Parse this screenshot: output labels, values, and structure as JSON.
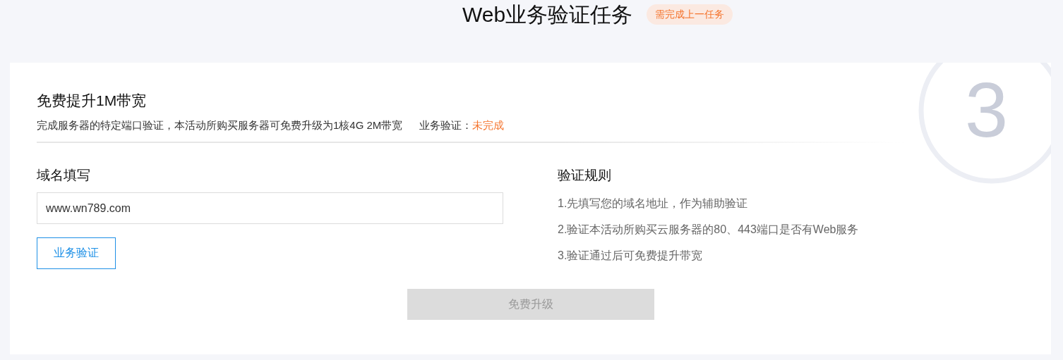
{
  "header": {
    "title": "Web业务验证任务",
    "badge": "需完成上一任务"
  },
  "task": {
    "step": "3",
    "title": "免费提升1M带宽",
    "description": "完成服务器的特定端口验证，本活动所购买服务器可免费升级为1核4G 2M带宽",
    "status_label": "业务验证：",
    "status_value": "未完成",
    "completed": false
  },
  "domain": {
    "label": "域名填写",
    "value": "www.wn789.com",
    "verify_button": "业务验证"
  },
  "rules": {
    "title": "验证规则",
    "items": [
      "1.先填写您的域名地址，作为辅助验证",
      "2.验证本活动所购买云服务器的80、443端口是否有Web服务",
      "3.验证通过后可免费提升带宽"
    ]
  },
  "upgrade_button": {
    "label": "免费升级",
    "disabled": true
  }
}
